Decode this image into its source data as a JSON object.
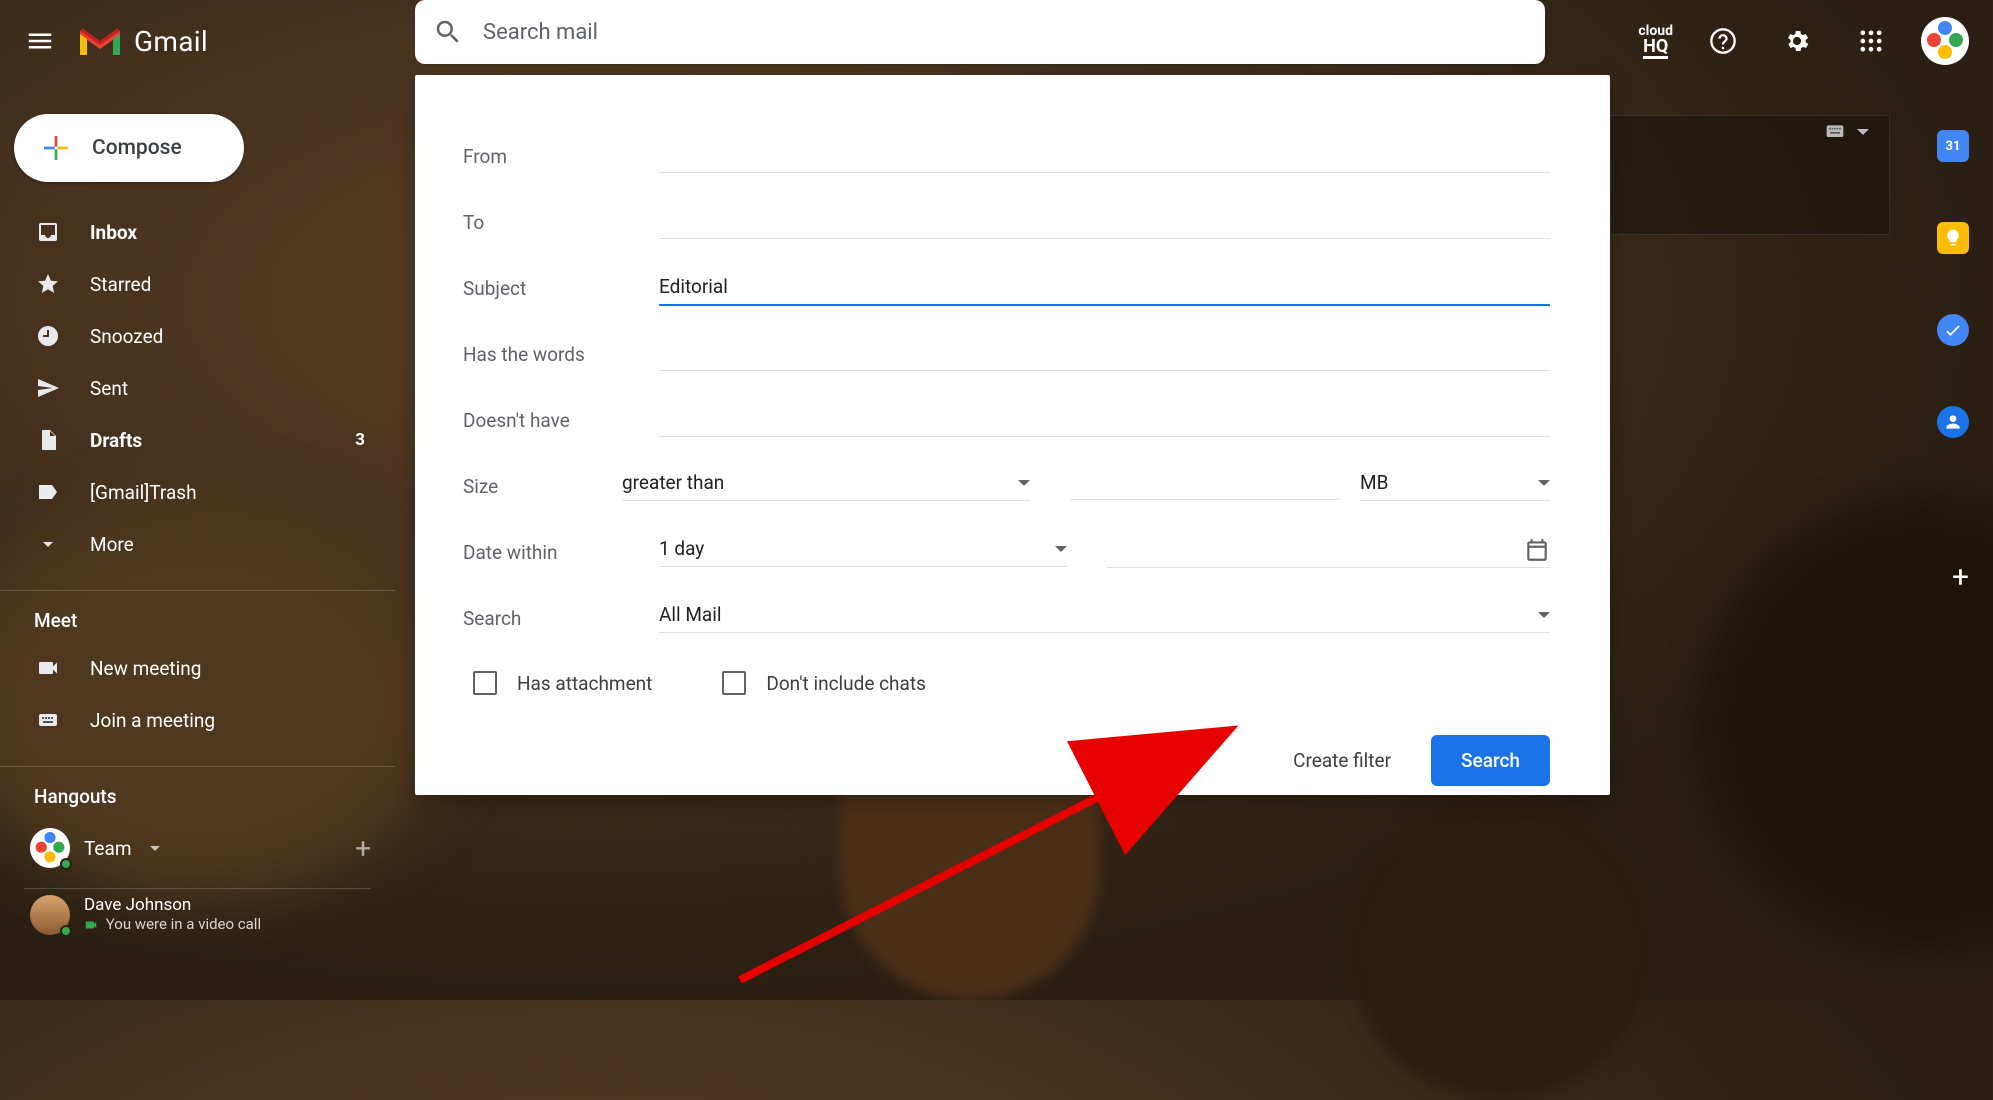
{
  "app": {
    "name": "Gmail"
  },
  "search": {
    "placeholder": "Search mail"
  },
  "header_icons": {
    "cloudhq_top": "cloud",
    "cloudhq_bottom": "HQ"
  },
  "compose_label": "Compose",
  "nav": {
    "inbox": "Inbox",
    "starred": "Starred",
    "snoozed": "Snoozed",
    "sent": "Sent",
    "drafts": "Drafts",
    "drafts_count": "3",
    "trash": "[Gmail]Trash",
    "more": "More"
  },
  "meet": {
    "label": "Meet",
    "new_meeting": "New meeting",
    "join_meeting": "Join a meeting"
  },
  "hangouts": {
    "label": "Hangouts",
    "team": "Team",
    "user": {
      "name": "Dave Johnson",
      "status": "You were in a video call"
    }
  },
  "filter": {
    "from_label": "From",
    "to_label": "To",
    "subject_label": "Subject",
    "subject_value": "Editorial",
    "has_words_label": "Has the words",
    "doesnt_have_label": "Doesn't have",
    "size_label": "Size",
    "size_operator": "greater than",
    "size_unit": "MB",
    "date_within_label": "Date within",
    "date_within_value": "1 day",
    "search_in_label": "Search",
    "search_in_value": "All Mail",
    "has_attachment": "Has attachment",
    "dont_include_chats": "Don't include chats",
    "create_filter": "Create filter",
    "search_button": "Search"
  },
  "rail": {
    "calendar_day": "31"
  }
}
